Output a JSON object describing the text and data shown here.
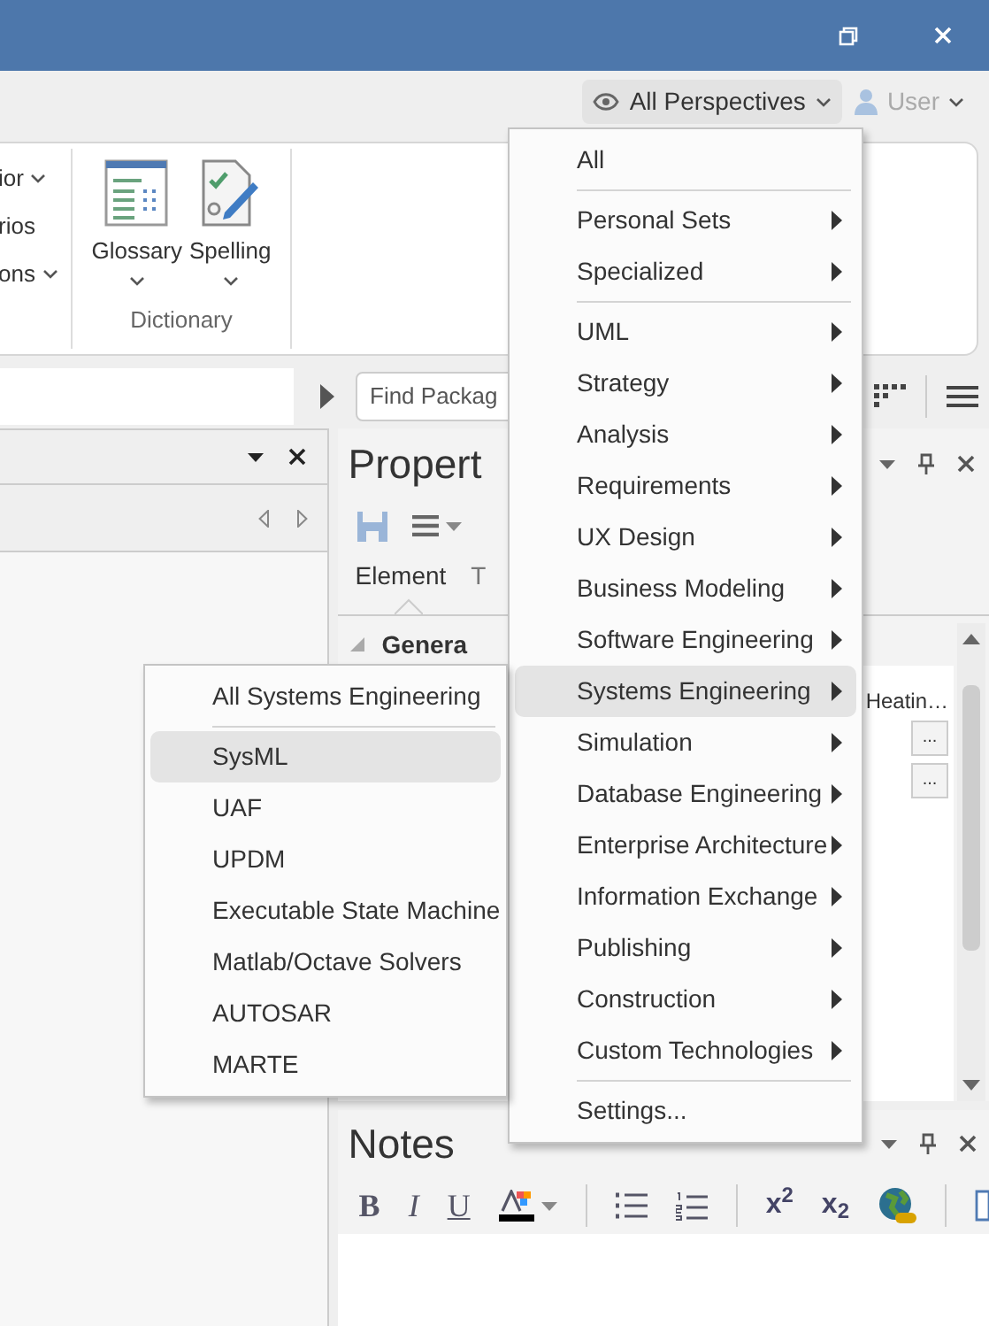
{
  "top_bar": {
    "perspective_button": "All Perspectives",
    "user_button": "User"
  },
  "ribbon": {
    "partial_items": [
      {
        "label": "ior",
        "dropdown": true
      },
      {
        "label": "rios",
        "dropdown": false
      },
      {
        "label": "ons",
        "dropdown": true
      }
    ],
    "group": {
      "label": "Dictionary",
      "buttons": [
        {
          "label": "Glossary",
          "kind": "glossary"
        },
        {
          "label": "Spelling",
          "kind": "spelling"
        }
      ]
    }
  },
  "toolbar": {
    "search": {
      "placeholder": "Find Packag"
    }
  },
  "properties": {
    "title": "Propert",
    "tabs": [
      {
        "label": "Element",
        "selected": true
      },
      {
        "label": "T",
        "selected": false
      }
    ],
    "section": "Genera",
    "value": "Heatin…",
    "ellipsis_buttons": [
      "...",
      "..."
    ]
  },
  "notes": {
    "title": "Notes",
    "format_buttons": [
      {
        "label": "B",
        "kind": "bold"
      },
      {
        "label": "I",
        "kind": "italic"
      },
      {
        "label": "U",
        "kind": "underline"
      }
    ],
    "script_buttons": [
      "x$^{2}$",
      "x$_{2}$"
    ]
  },
  "perspective_menu": {
    "items": [
      {
        "kind": "item",
        "label": "All",
        "selected": false
      },
      {
        "kind": "separator"
      },
      {
        "kind": "submenu",
        "label": "Personal Sets",
        "selected": false
      },
      {
        "kind": "submenu",
        "label": "Specialized",
        "selected": false
      },
      {
        "kind": "separator"
      },
      {
        "kind": "submenu",
        "label": "UML",
        "selected": false
      },
      {
        "kind": "submenu",
        "label": "Strategy",
        "selected": false
      },
      {
        "kind": "submenu",
        "label": "Analysis",
        "selected": false
      },
      {
        "kind": "submenu",
        "label": "Requirements",
        "selected": false
      },
      {
        "kind": "submenu",
        "label": "UX Design",
        "selected": false
      },
      {
        "kind": "submenu",
        "label": "Business Modeling",
        "selected": false
      },
      {
        "kind": "submenu",
        "label": "Software Engineering",
        "selected": false
      },
      {
        "kind": "submenu",
        "label": "Systems Engineering",
        "selected": true
      },
      {
        "kind": "submenu",
        "label": "Simulation",
        "selected": false
      },
      {
        "kind": "submenu",
        "label": "Database Engineering",
        "selected": false
      },
      {
        "kind": "submenu",
        "label": "Enterprise Architecture",
        "selected": false
      },
      {
        "kind": "submenu",
        "label": "Information Exchange",
        "selected": false
      },
      {
        "kind": "submenu",
        "label": "Publishing",
        "selected": false
      },
      {
        "kind": "submenu",
        "label": "Construction",
        "selected": false
      },
      {
        "kind": "submenu",
        "label": "Custom Technologies",
        "selected": false
      },
      {
        "kind": "separator"
      },
      {
        "kind": "item",
        "label": "Settings...",
        "selected": false
      }
    ]
  },
  "systems_submenu": {
    "items": [
      {
        "kind": "item",
        "label": "All Systems Engineering",
        "selected": false
      },
      {
        "kind": "separator"
      },
      {
        "kind": "item",
        "label": "SysML",
        "selected": true
      },
      {
        "kind": "item",
        "label": "UAF",
        "selected": false
      },
      {
        "kind": "item",
        "label": "UPDM",
        "selected": false
      },
      {
        "kind": "item",
        "label": "Executable State Machine",
        "selected": false
      },
      {
        "kind": "item",
        "label": "Matlab/Octave Solvers",
        "selected": false
      },
      {
        "kind": "item",
        "label": "AUTOSAR",
        "selected": false
      },
      {
        "kind": "item",
        "label": "MARTE",
        "selected": false
      }
    ]
  }
}
